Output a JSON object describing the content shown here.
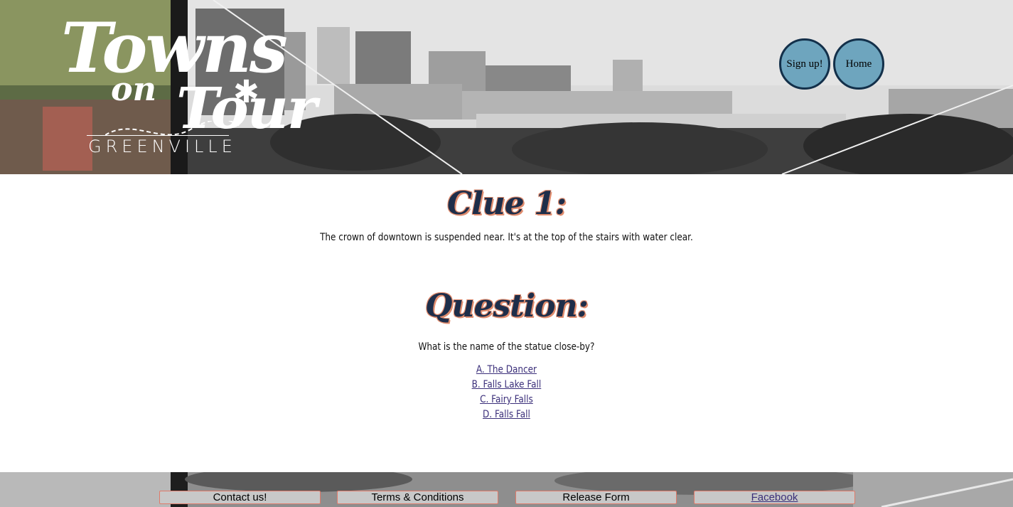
{
  "header": {
    "logo": {
      "word1": "Towns",
      "word2": "on",
      "word3": "Tour",
      "city": "GREENVILLE"
    },
    "nav": {
      "signup_label": "Sign up!",
      "home_label": "Home"
    }
  },
  "main": {
    "clue_heading": "Clue 1:",
    "clue_text": "The crown of downtown is suspended near. It's at the top of the stairs with water clear.",
    "question_heading": "Question:",
    "question_text": "What is the name of the statue close-by?",
    "answers": [
      "A. The Dancer",
      "B. Falls Lake Fall",
      "C. Fairy Falls",
      "D. Falls Fall"
    ]
  },
  "footer": {
    "contact_label": "Contact us!",
    "terms_label": "Terms & Conditions",
    "release_label": "Release Form",
    "facebook_label": "Facebook"
  },
  "colors": {
    "nav_button_fill": "#6ea5be",
    "nav_button_border": "#13304a",
    "heading_color": "#1e2e4a",
    "heading_outline": "#e08c6e",
    "link_color": "#3b2f7a"
  }
}
